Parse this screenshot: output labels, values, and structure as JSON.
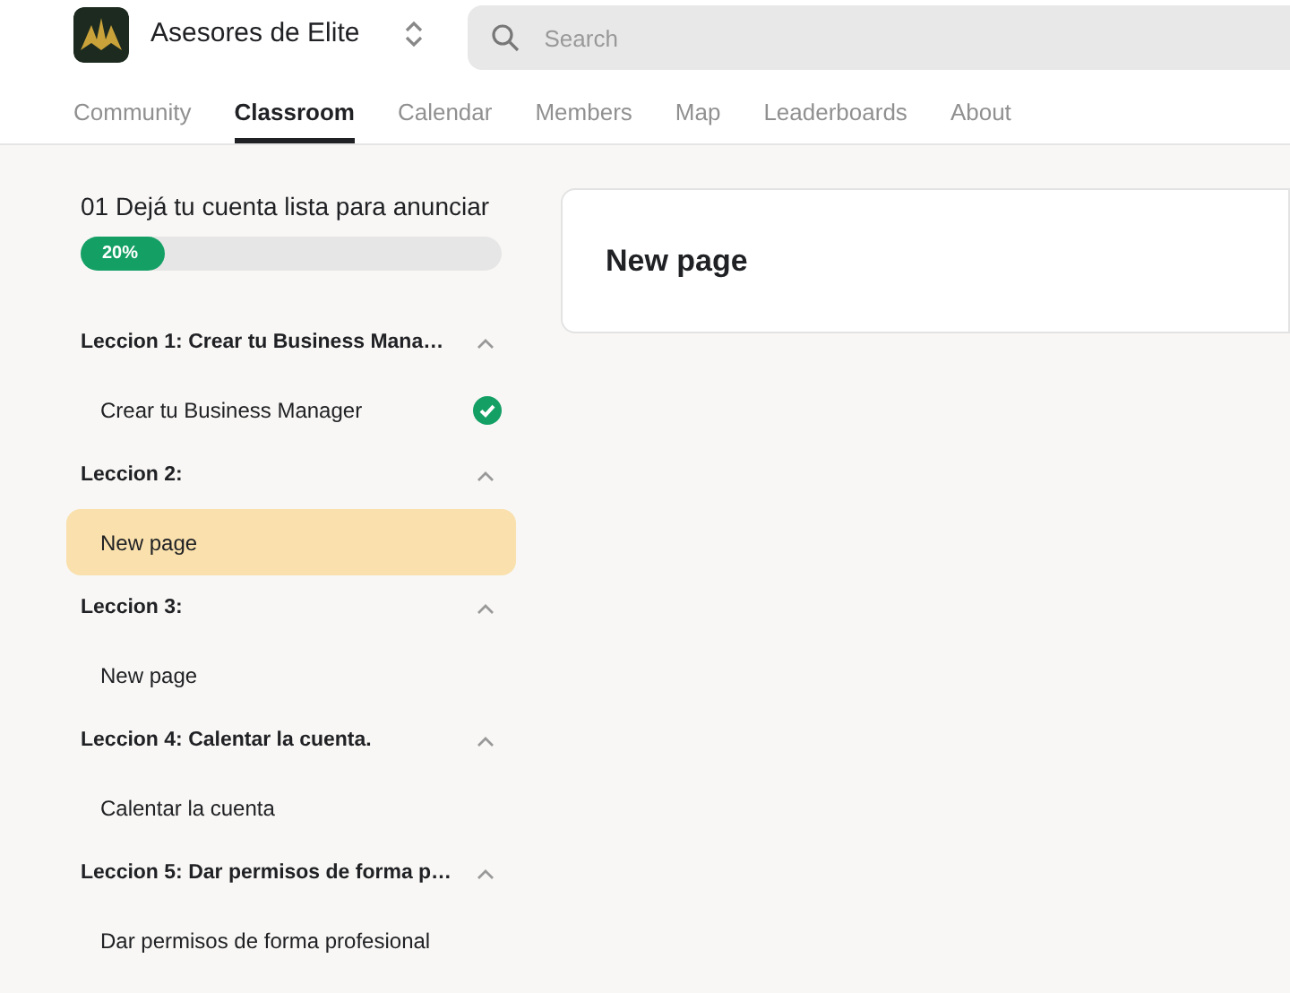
{
  "header": {
    "group_name": "Asesores de Elite",
    "search": {
      "placeholder": "Search"
    }
  },
  "tabs": [
    {
      "label": "Community",
      "selected": false
    },
    {
      "label": "Classroom",
      "selected": true
    },
    {
      "label": "Calendar",
      "selected": false
    },
    {
      "label": "Members",
      "selected": false
    },
    {
      "label": "Map",
      "selected": false
    },
    {
      "label": "Leaderboards",
      "selected": false
    },
    {
      "label": "About",
      "selected": false
    }
  ],
  "course": {
    "title": "01 Dejá tu cuenta lista para anunciar",
    "progress": {
      "label": "20%",
      "level": 0.2
    },
    "lessons": [
      {
        "title": "Leccion 1: Crear tu Business Mana…",
        "expanded": true,
        "children": [
          {
            "title": "Crear tu Business Manager",
            "selected": false,
            "completed": true
          }
        ]
      },
      {
        "title": "Leccion 2:",
        "expanded": true,
        "children": [
          {
            "title": "New page",
            "selected": true,
            "completed": false
          }
        ]
      },
      {
        "title": "Leccion 3:",
        "expanded": true,
        "children": [
          {
            "title": "New page",
            "selected": false,
            "completed": false
          }
        ]
      },
      {
        "title": "Leccion 4: Calentar la cuenta.",
        "expanded": true,
        "children": [
          {
            "title": "Calentar la cuenta",
            "selected": false,
            "completed": false
          }
        ]
      },
      {
        "title": "Leccion 5: Dar permisos de forma p…",
        "expanded": true,
        "children": [
          {
            "title": "Dar permisos de forma profesional",
            "selected": false,
            "completed": false
          }
        ]
      }
    ]
  },
  "content": {
    "title": "New page"
  }
}
